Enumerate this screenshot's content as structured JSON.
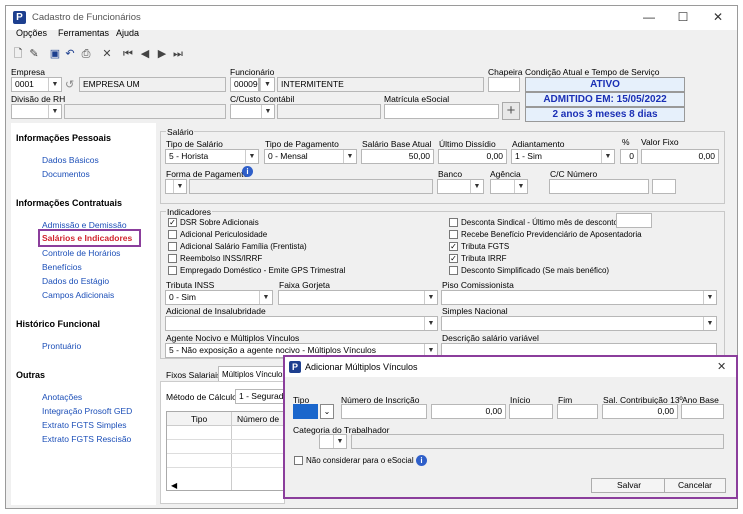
{
  "window": {
    "title": "Cadastro de Funcionários"
  },
  "menu": [
    "Opções",
    "Ferramentas",
    "Ajuda"
  ],
  "header": {
    "empresa_label": "Empresa",
    "empresa_code": "0001",
    "empresa_name": "EMPRESA UM",
    "funcionario_label": "Funcionário",
    "funcionario_code": "00009",
    "funcionario_name": "INTERMITENTE",
    "chapeira_label": "Chapeira",
    "condicao_label": "Condição Atual e Tempo de Serviço",
    "status_ativo": "ATIVO",
    "status_admitido": "ADMITIDO EM: 15/05/2022",
    "status_tempo": "2 anos 3 meses 8 dias",
    "divisao_label": "Divisão de RH",
    "custo_label": "C/Custo Contábil",
    "matricula_label": "Matrícula eSocial"
  },
  "sidebar": {
    "pessoais_title": "Informações Pessoais",
    "dados_basicos": "Dados Básicos",
    "documentos": "Documentos",
    "contratuais_title": "Informações Contratuais",
    "admissao": "Admissão e Demissão",
    "salarios": "Salários e Indicadores",
    "horarios": "Controle de Horários",
    "beneficios": "Benefícios",
    "estagio": "Dados do Estágio",
    "adicionais": "Campos Adicionais",
    "historico_title": "Histórico Funcional",
    "prontuario": "Prontuário",
    "outras_title": "Outras",
    "anotacoes": "Anotações",
    "integracao": "Integração Prosoft GED",
    "extrato_simples": "Extrato FGTS Simples",
    "extrato_rescisao": "Extrato FGTS Rescisão"
  },
  "salario": {
    "group": "Salário",
    "tipo_label": "Tipo de Salário",
    "tipo_value": "5 - Horista",
    "pagto_label": "Tipo de Pagamento",
    "pagto_value": "0 - Mensal",
    "base_label": "Salário Base Atual",
    "base_value": "50,00",
    "dissidio_label": "Último Dissídio",
    "dissidio_value": "0,00",
    "adiant_label": "Adiantamento",
    "adiant_value": "1 - Sim",
    "pct_label": "%",
    "pct_value": "0",
    "fixo_label": "Valor Fixo",
    "fixo_value": "0,00",
    "forma_label": "Forma de Pagamento",
    "banco_label": "Banco",
    "agencia_label": "Agência",
    "cc_label": "C/C Número"
  },
  "indicadores": {
    "group": "Indicadores",
    "left": [
      {
        "label": "DSR Sobre Adicionais",
        "checked": "✓"
      },
      {
        "label": "Adicional Periculosidade",
        "checked": ""
      },
      {
        "label": "Adicional Salário Família (Frentista)",
        "checked": ""
      },
      {
        "label": "Reembolso INSS/IRRF",
        "checked": ""
      },
      {
        "label": "Empregado Doméstico - Emite GPS Trimestral",
        "checked": ""
      }
    ],
    "right": [
      {
        "label": "Desconta Sindical - Último mês de desconto",
        "checked": ""
      },
      {
        "label": "Recebe Benefício Previdenciário de Aposentadoria",
        "checked": ""
      },
      {
        "label": "Tributa FGTS",
        "checked": "✓"
      },
      {
        "label": "Tributa IRRF",
        "checked": "✓"
      },
      {
        "label": "Desconto Simplificado (Se mais benéfico)",
        "checked": ""
      }
    ],
    "inss_label": "Tributa INSS",
    "inss_value": "0 - Sim",
    "gorjeta_label": "Faixa Gorjeta",
    "comissionista_label": "Piso Comissionista",
    "insalub_label": "Adicional de Insalubridade",
    "simples_label": "Simples Nacional",
    "agente_label": "Agente Nocivo e  Múltiplos Vínculos",
    "agente_value": "5 - Não exposição a agente nocivo - Múltiplos Vínculos",
    "descricao_label": "Descrição salário variável"
  },
  "tabs": {
    "fixos": "Fixos Salariais",
    "multiplos": "Múltiplos Vínculos"
  },
  "bottom": {
    "metodo_label": "Método de Cálculo",
    "metodo_value": "1 - Segurado",
    "col_tipo": "Tipo",
    "col_numero": "Número de"
  },
  "dialog": {
    "title": "Adicionar Múltiplos Vínculos",
    "tipo_label": "Tipo",
    "inscricao_label": "Número de Inscrição",
    "base_value": "0,00",
    "inicio_label": "Início",
    "fim_label": "Fim",
    "contrib_label": "Sal. Contribuição 13º",
    "contrib_value": "0,00",
    "ano_label": "Ano Base",
    "categoria_label": "Categoria do Trabalhador",
    "esocial_label": "Não considerar para o eSocial",
    "save": "Salvar",
    "cancel": "Cancelar"
  }
}
